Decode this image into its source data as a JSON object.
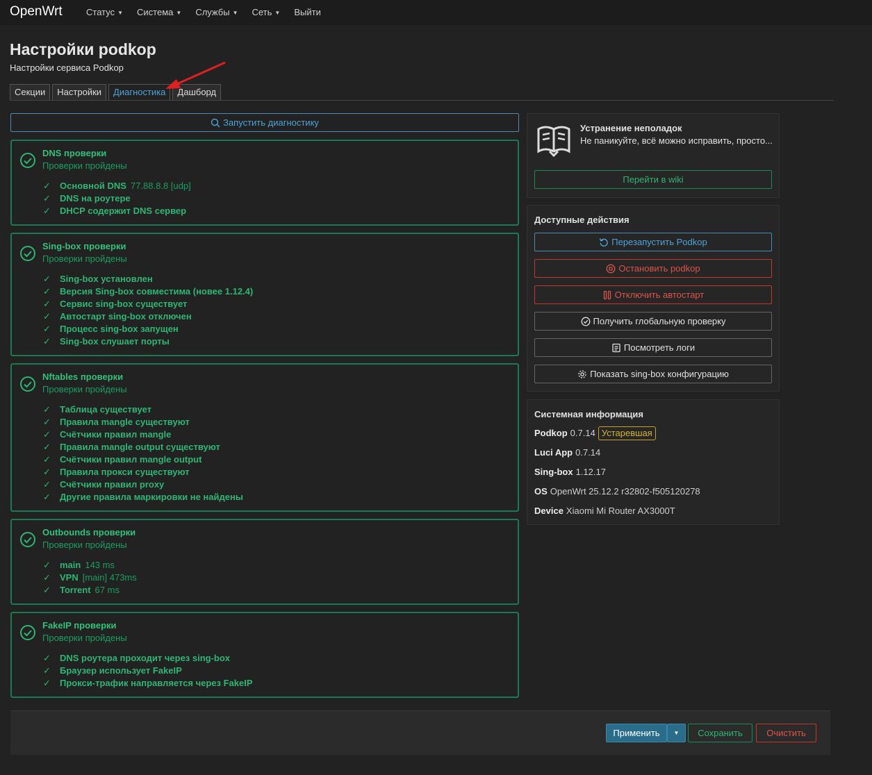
{
  "nav": {
    "brand": "OpenWrt",
    "menu": [
      "Статус",
      "Система",
      "Службы",
      "Сеть"
    ],
    "logout": "Выйти"
  },
  "page": {
    "title": "Настройки podkop",
    "subtitle": "Настройки сервиса Podkop"
  },
  "tabs": [
    "Секции",
    "Настройки",
    "Диагностика",
    "Дашборд"
  ],
  "active_tab": "Диагностика",
  "run_button": "Запустить диагностику",
  "checks": [
    {
      "title": "DNS проверки",
      "status": "Проверки пройдены",
      "items": [
        {
          "label": "Основной DNS",
          "value": "77.88.8.8 [udp]"
        },
        {
          "label": "DNS на роутере",
          "value": ""
        },
        {
          "label": "DHCP содержит DNS сервер",
          "value": ""
        }
      ]
    },
    {
      "title": "Sing-box проверки",
      "status": "Проверки пройдены",
      "items": [
        {
          "label": "Sing-box установлен",
          "value": ""
        },
        {
          "label": "Версия Sing-box совместима (новее 1.12.4)",
          "value": ""
        },
        {
          "label": "Сервис sing-box существует",
          "value": ""
        },
        {
          "label": "Автостарт sing-box отключен",
          "value": ""
        },
        {
          "label": "Процесс sing-box запущен",
          "value": ""
        },
        {
          "label": "Sing-box слушает порты",
          "value": ""
        }
      ]
    },
    {
      "title": "Nftables проверки",
      "status": "Проверки пройдены",
      "items": [
        {
          "label": "Таблица существует",
          "value": ""
        },
        {
          "label": "Правила mangle существуют",
          "value": ""
        },
        {
          "label": "Счётчики правил mangle",
          "value": ""
        },
        {
          "label": "Правила mangle output существуют",
          "value": ""
        },
        {
          "label": "Счётчики правил mangle output",
          "value": ""
        },
        {
          "label": "Правила прокси существуют",
          "value": ""
        },
        {
          "label": "Счётчики правил proxy",
          "value": ""
        },
        {
          "label": "Другие правила маркировки не найдены",
          "value": ""
        }
      ]
    },
    {
      "title": "Outbounds проверки",
      "status": "Проверки пройдены",
      "items": [
        {
          "label": "main",
          "value": "143 ms"
        },
        {
          "label": "VPN",
          "value": "[main] 473ms"
        },
        {
          "label": "Torrent",
          "value": "67 ms"
        }
      ]
    },
    {
      "title": "FakeIP проверки",
      "status": "Проверки пройдены",
      "items": [
        {
          "label": "DNS роутера проходит через sing-box",
          "value": ""
        },
        {
          "label": "Браузер использует FakeIP",
          "value": ""
        },
        {
          "label": "Прокси-трафик направляется через FakeIP",
          "value": ""
        }
      ]
    }
  ],
  "troubleshoot": {
    "title": "Устранение неполадок",
    "text": "Не паникуйте, всё можно исправить, просто...",
    "wiki_button": "Перейти в wiki"
  },
  "actions": {
    "heading": "Доступные действия",
    "restart": "Перезапустить Podkop",
    "stop": "Остановить podkop",
    "disable_autostart": "Отключить автостарт",
    "global_check": "Получить глобальную проверку",
    "view_logs": "Посмотреть логи",
    "show_config": "Показать sing-box конфигурацию"
  },
  "sysinfo": {
    "heading": "Системная информация",
    "rows": [
      {
        "key": "Podkop",
        "value": "0.7.14",
        "badge": "Устаревшая"
      },
      {
        "key": "Luci App",
        "value": "0.7.14"
      },
      {
        "key": "Sing-box",
        "value": "1.12.17"
      },
      {
        "key": "OS",
        "value": "OpenWrt 25.12.2 r32802-f505120278"
      },
      {
        "key": "Device",
        "value": "Xiaomi Mi Router AX3000T"
      }
    ]
  },
  "footer": {
    "apply": "Применить",
    "save": "Сохранить",
    "clear": "Очистить"
  },
  "colors": {
    "success": "#2fb574",
    "primary": "#4da3d9",
    "danger": "#e0524a",
    "warning": "#d4b13a"
  }
}
